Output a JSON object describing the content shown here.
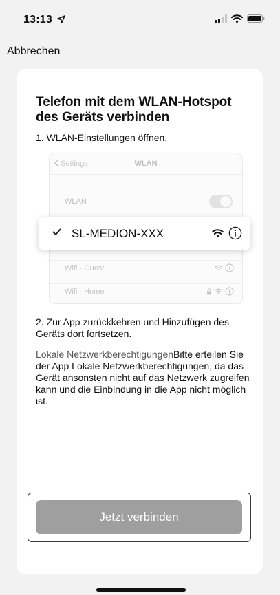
{
  "status_bar": {
    "time": "13:13",
    "icons": [
      "location-arrow-icon",
      "signal-icon",
      "wifi-icon",
      "battery-icon"
    ]
  },
  "nav": {
    "cancel_label": "Abbrechen"
  },
  "card": {
    "title": "Telefon mit dem WLAN-Hotspot des Geräts verbinden",
    "step1": "1. WLAN-Einstellungen öffnen.",
    "settings_illustration": {
      "back_label": "Settings",
      "nav_title": "WLAN",
      "wlan_label": "WLAN",
      "toggle_on": true,
      "selected_network": "SL-MEDION-XXX",
      "other_networks": [
        "Wifi - Guest",
        "Wifi - Home"
      ]
    },
    "step2": "2. Zur App zurückkehren und Hinzufügen des Geräts dort fortsetzen.",
    "permission_heading": "Lokale Netzwerkberechtigungen",
    "permission_text": "Bitte erteilen Sie der App Lokale Netzwerkberechtigungen, da das Gerät ansonsten nicht auf das Netzwerk zugreifen kann und die Einbindung in die App nicht möglich ist.",
    "connect_button": "Jetzt verbinden"
  },
  "colors": {
    "background": "#f2f2f2",
    "card": "#ffffff",
    "button": "#9f9f9f",
    "button_text": "#ffffff"
  }
}
